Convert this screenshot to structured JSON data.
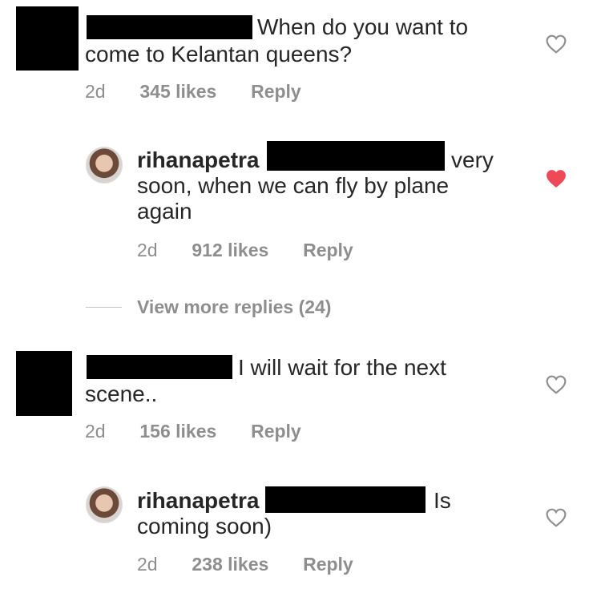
{
  "comments": [
    {
      "text_line1": "When do you want to",
      "text_line2": "come to Kelantan queens?",
      "time": "2d",
      "likes": "345 likes",
      "reply": "Reply",
      "liked": false
    },
    {
      "username": "rihanapetra",
      "text_tail": "very",
      "text_line2": "soon, when we can fly by plane",
      "text_line3": "again",
      "time": "2d",
      "likes": "912 likes",
      "reply": "Reply",
      "liked": true
    },
    {
      "text_line1": "I will wait for the next",
      "text_line2": "scene..",
      "time": "2d",
      "likes": "156 likes",
      "reply": "Reply",
      "liked": false
    },
    {
      "username": "rihanapetra",
      "text_tail": "Is",
      "text_line2": "coming soon)",
      "time": "2d",
      "likes": "238 likes",
      "reply": "Reply",
      "liked": false
    }
  ],
  "view_more_replies": "View more replies (24)",
  "colors": {
    "liked_heart": "#ed4956",
    "outline_heart": "#8e8e8e"
  }
}
